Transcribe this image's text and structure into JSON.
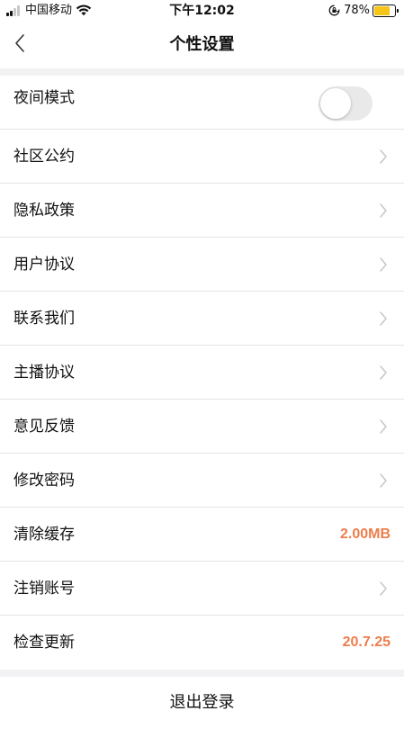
{
  "status_bar": {
    "carrier": "中国移动",
    "time": "下午12:02",
    "battery_percent": "78%",
    "battery_level": 0.78,
    "battery_color": "#f5c518"
  },
  "nav": {
    "back_icon": "chevron-left-icon",
    "title": "个性设置"
  },
  "settings": {
    "night_mode": {
      "label": "夜间模式",
      "enabled": false
    },
    "items": [
      {
        "label": "社区公约",
        "accessory": "chevron"
      },
      {
        "label": "隐私政策",
        "accessory": "chevron"
      },
      {
        "label": "用户协议",
        "accessory": "chevron"
      },
      {
        "label": "联系我们",
        "accessory": "chevron"
      },
      {
        "label": "主播协议",
        "accessory": "chevron"
      },
      {
        "label": "意见反馈",
        "accessory": "chevron"
      },
      {
        "label": "修改密码",
        "accessory": "chevron"
      },
      {
        "label": "清除缓存",
        "accessory": "value",
        "value": "2.00MB"
      },
      {
        "label": "注销账号",
        "accessory": "chevron"
      },
      {
        "label": "检查更新",
        "accessory": "value",
        "value": "20.7.25"
      }
    ]
  },
  "logout": {
    "label": "退出登录"
  },
  "colors": {
    "accent_value": "#ee7d4b",
    "separator": "#e3e3e3",
    "section_gap": "#f2f2f4"
  }
}
